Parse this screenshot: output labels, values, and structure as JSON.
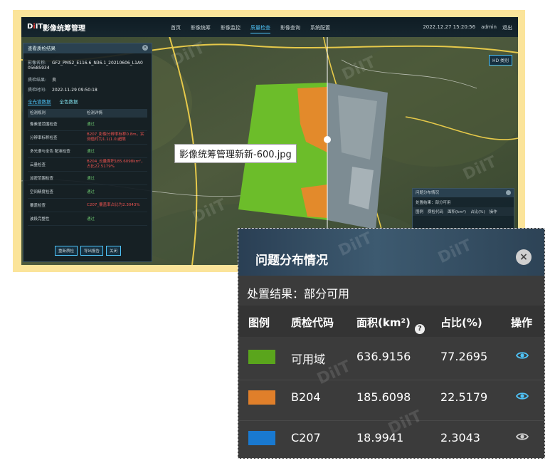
{
  "app": {
    "logo": {
      "left": "D",
      "mark": "i",
      "right": "IT"
    },
    "title": "影像统筹管理",
    "nav": [
      "首页",
      "影像统筹",
      "影像监控",
      "质量检查",
      "影像查询",
      "系统配置"
    ],
    "datetime": "2022.12.27 15:20:56",
    "user": "admin",
    "logout": "退出",
    "hd_button": "HD 类别"
  },
  "side_panel": {
    "title": "查看质检结果",
    "image_name_label": "影像名称:",
    "image_name_value": "GF2_PMS2_E116.6_N36.1_20210606_L1A0 05685934",
    "result_label": "质检结果:",
    "result_value": "良",
    "time_label": "质检时间:",
    "time_value": "2022-11-29 09:50:18",
    "tabs": [
      "全光谱数据",
      "全色数据"
    ],
    "rules_header": [
      "检测规则",
      "检测详情"
    ],
    "rules": [
      {
        "name": "像素值范围检查",
        "detail": "通过",
        "status": "ok"
      },
      {
        "name": "分辨率标称检查",
        "detail": "B207_影像分辨率标称0.8m，实测值约为1.1(1.0)超限",
        "status": "bad"
      },
      {
        "name": "多光谱与全色 配准检查",
        "detail": "通过",
        "status": "ok"
      },
      {
        "name": "云量检查",
        "detail": "B204_云量面积185.6098km²，占比22.5179%",
        "status": "bad"
      },
      {
        "name": "加密范围检查",
        "detail": "通过",
        "status": "ok"
      },
      {
        "name": "空间精度检查",
        "detail": "通过",
        "status": "ok"
      },
      {
        "name": "覆盖检查",
        "detail": "C207_覆盖率占比为2.3043%",
        "status": "bad"
      },
      {
        "name": "波段完整性",
        "detail": "通过",
        "status": "ok"
      }
    ],
    "buttons": [
      "重新质检",
      "导出报告",
      "关闭"
    ]
  },
  "tooltip": "影像统筹管理新新-600.jpg",
  "mini_panel": {
    "title": "问题分布情况",
    "result": "处置结果：部分可用",
    "cols": [
      "图例",
      "质检代码",
      "面积(km²)",
      "占比(%)",
      "操作"
    ]
  },
  "detail_panel": {
    "title": "问题分布情况",
    "close": "×",
    "result": "处置结果：部分可用",
    "columns": {
      "legend": "图例",
      "code": "质检代码",
      "area": "面积(km²)",
      "ratio": "占比(%)",
      "action": "操作"
    },
    "help": "?",
    "rows": [
      {
        "color": "#5aa51c",
        "code": "可用域",
        "area": "636.9156",
        "ratio": "77.2695",
        "eye": "#4fc3f7"
      },
      {
        "color": "#e07f2a",
        "code": "B204",
        "area": "185.6098",
        "ratio": "22.5179",
        "eye": "#4fc3f7"
      },
      {
        "color": "#1979d0",
        "code": "C207",
        "area": "18.9941",
        "ratio": "2.3043",
        "eye": "#cfcfcf"
      }
    ]
  },
  "colors": {
    "accent": "#4fc3f7",
    "ok": "#66bb6a",
    "bad": "#ef5350"
  },
  "watermark": "DiIT"
}
